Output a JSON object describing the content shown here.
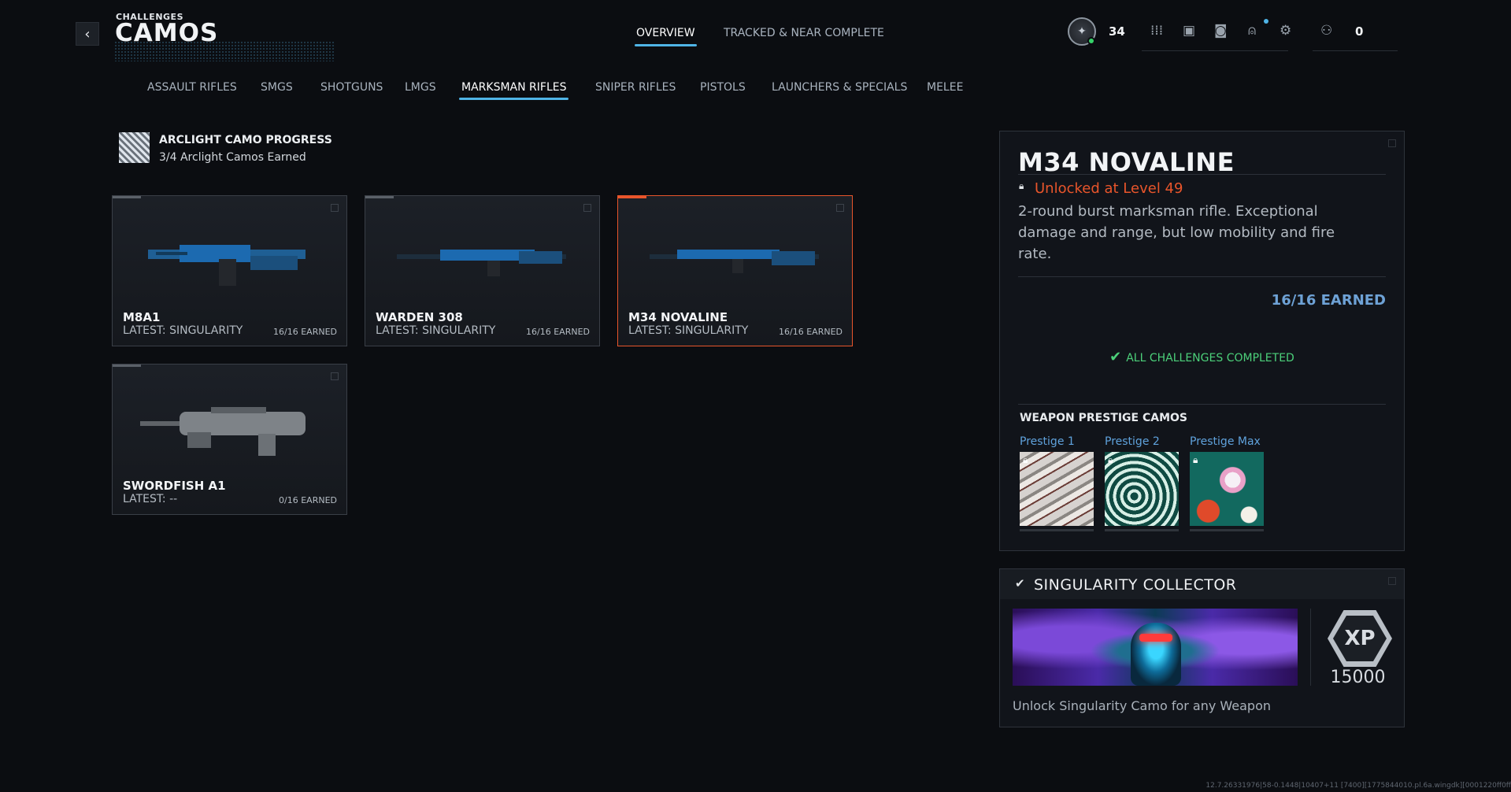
{
  "header": {
    "breadcrumb": "CHALLENGES",
    "title": "CAMOS",
    "back_icon": "chevron-left-icon"
  },
  "top_tabs": [
    {
      "label": "OVERVIEW",
      "active": true
    },
    {
      "label": "TRACKED & NEAR COMPLETE",
      "active": false
    }
  ],
  "hud": {
    "level": "34",
    "currency": "0",
    "icons": [
      "rank-badge-icon",
      "grid-icon",
      "unlock-icon",
      "camera-icon",
      "bell-icon",
      "gear-icon",
      "party-icon"
    ]
  },
  "categories": [
    {
      "label": "ASSAULT RIFLES",
      "active": false
    },
    {
      "label": "SMGS",
      "active": false
    },
    {
      "label": "SHOTGUNS",
      "active": false
    },
    {
      "label": "LMGS",
      "active": false
    },
    {
      "label": "MARKSMAN RIFLES",
      "active": true
    },
    {
      "label": "SNIPER RIFLES",
      "active": false
    },
    {
      "label": "PISTOLS",
      "active": false
    },
    {
      "label": "LAUNCHERS & SPECIALS",
      "active": false
    },
    {
      "label": "MELEE",
      "active": false
    }
  ],
  "progress": {
    "title": "ARCLIGHT CAMO PROGRESS",
    "subtitle": "3/4 Arclight Camos Earned"
  },
  "weapons": [
    {
      "name": "M8A1",
      "latest": "LATEST: SINGULARITY",
      "earned": "16/16 EARNED",
      "selected": false
    },
    {
      "name": "WARDEN 308",
      "latest": "LATEST: SINGULARITY",
      "earned": "16/16 EARNED",
      "selected": false
    },
    {
      "name": "M34 NOVALINE",
      "latest": "LATEST: SINGULARITY",
      "earned": "16/16 EARNED",
      "selected": true
    },
    {
      "name": "SWORDFISH A1",
      "latest": "LATEST: --",
      "earned": "0/16 EARNED",
      "selected": false
    }
  ],
  "detail": {
    "title": "M34 NOVALINE",
    "unlock": "Unlocked at Level 49",
    "description": "2-round burst marksman rifle. Exceptional damage and range, but low mobility and fire rate.",
    "earned": "16/16 EARNED",
    "status": "ALL CHALLENGES COMPLETED",
    "prestige_heading": "WEAPON PRESTIGE CAMOS",
    "prestige": [
      {
        "label": "Prestige 1"
      },
      {
        "label": "Prestige 2"
      },
      {
        "label": "Prestige Max"
      }
    ]
  },
  "reward": {
    "title": "SINGULARITY COLLECTOR",
    "xp_label": "XP",
    "xp_amount": "15000",
    "description": "Unlock Singularity Camo for any Weapon"
  },
  "footer": "12.7.26331976|58-0.1448|10407+11 [7400][1775844010.pl.6a.wingdk][0001220ff0ff",
  "colors": {
    "accent_blue": "#4fb4e6",
    "selected_orange": "#e8552b",
    "complete_green": "#4cd07a",
    "earned_blue": "#6ea2d6"
  }
}
